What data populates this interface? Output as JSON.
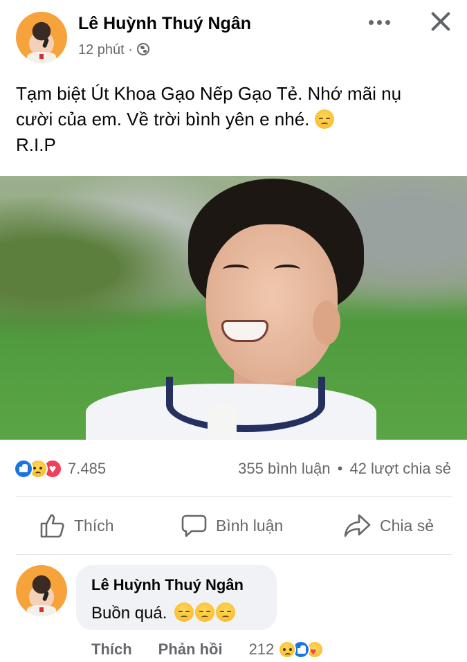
{
  "post": {
    "author_name": "Lê Huỳnh Thuý Ngân",
    "time": "12 phút",
    "separator": "·",
    "audience_icon": "globe-icon",
    "text_line1": "Tạm biệt Út Khoa Gạo Nếp Gạo Tẻ. Nhớ mãi nụ",
    "text_line2": "cười của em. Về trời bình yên e nhé.",
    "text_line3": "R.I.P"
  },
  "stats": {
    "reactions_count": "7.485",
    "comments": "355 bình luận",
    "bullet": "•",
    "shares": "42 lượt chia sẻ",
    "reaction_icons": [
      "like-icon",
      "sad-icon",
      "love-icon"
    ]
  },
  "actions": {
    "like_label": "Thích",
    "comment_label": "Bình luận",
    "share_label": "Chia sẻ"
  },
  "comment": {
    "author_name": "Lê Huỳnh Thuý Ngân",
    "text": "Buồn quá.",
    "emoji_count": 3,
    "like_label": "Thích",
    "reply_label": "Phản hồi",
    "reactions_count": "212",
    "reaction_icons": [
      "sad-icon",
      "like-icon",
      "care-icon"
    ]
  },
  "colors": {
    "secondary_text": "#65676b",
    "like_blue": "#1b74e4",
    "love_red": "#f33e58",
    "bubble_bg": "#f0f2f5"
  }
}
